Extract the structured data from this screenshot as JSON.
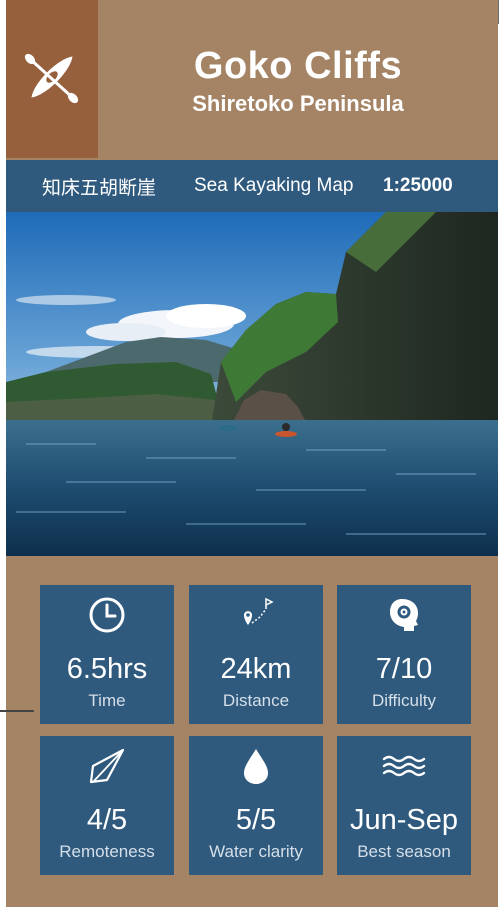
{
  "header": {
    "title": "Goko Cliffs",
    "subtitle": "Shiretoko Peninsula",
    "icon": "kayak-icon"
  },
  "band": {
    "japanese_name": "知床五胡断崖",
    "map_type": "Sea Kayaking Map",
    "scale": "1:25000"
  },
  "stats": [
    {
      "icon": "clock-icon",
      "value": "6.5hrs",
      "label": "Time"
    },
    {
      "icon": "route-icon",
      "value": "24km",
      "label": "Distance"
    },
    {
      "icon": "brain-gear-icon",
      "value": "7/10",
      "label": "Difficulty"
    },
    {
      "icon": "compass-icon",
      "value": "4/5",
      "label": "Remoteness"
    },
    {
      "icon": "water-drop-icon",
      "value": "5/5",
      "label": "Water clarity"
    },
    {
      "icon": "waves-icon",
      "value": "Jun-Sep",
      "label": "Best season"
    }
  ],
  "colors": {
    "card_tan": "#a58465",
    "icon_brown": "#97603d",
    "navy_blue": "#2f5a7e"
  }
}
